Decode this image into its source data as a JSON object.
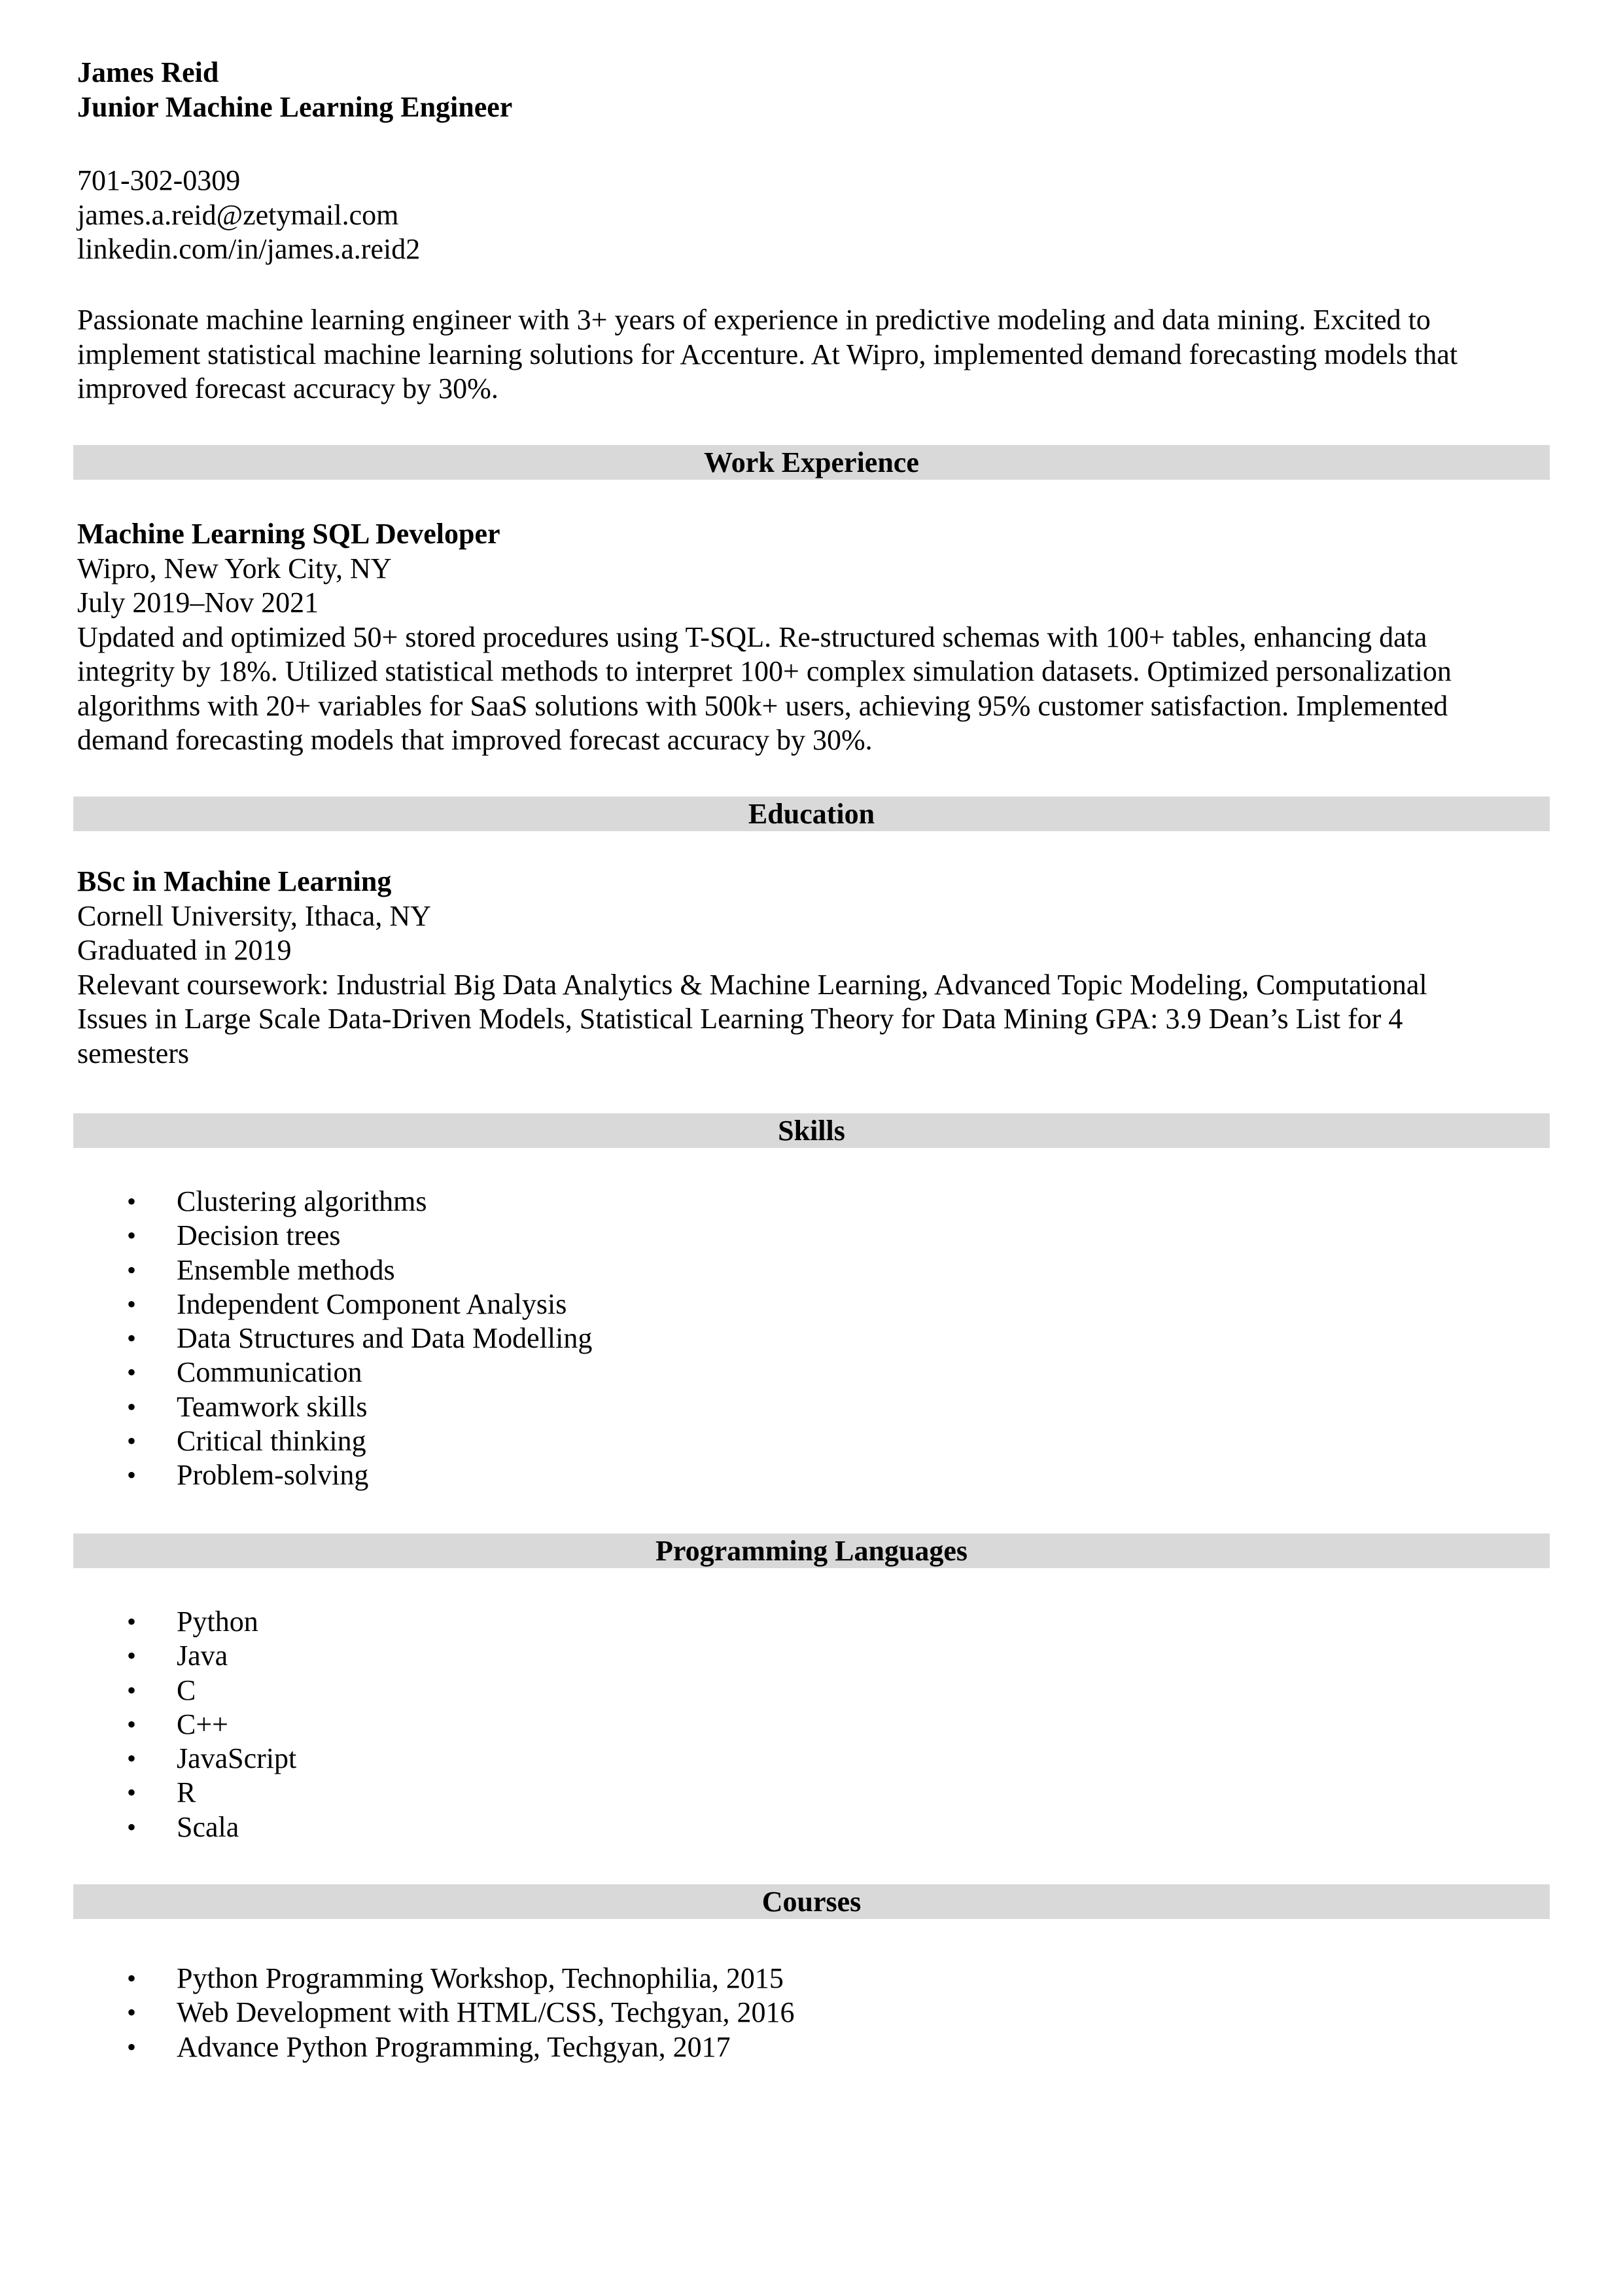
{
  "header": {
    "name": "James Reid",
    "title": "Junior Machine Learning Engineer",
    "phone": "701-302-0309",
    "email": "james.a.reid@zetymail.com",
    "linkedin": "linkedin.com/in/james.a.reid2"
  },
  "summary": {
    "lines": [
      "Passionate machine learning engineer with 3+ years of experience in predictive modeling and data mining. Excited to",
      "implement statistical machine learning solutions for Accenture. At Wipro, implemented demand forecasting models that",
      "improved forecast accuracy by 30%."
    ]
  },
  "sections": {
    "work_experience": "Work Experience",
    "education": "Education",
    "skills": "Skills",
    "programming_languages": "Programming Languages",
    "courses": "Courses"
  },
  "work": {
    "job_title": "Machine Learning SQL Developer",
    "company": "Wipro, New York City, NY",
    "dates": "July 2019–Nov 2021",
    "description_lines": [
      "Updated and optimized 50+ stored procedures using T-SQL. Re-structured schemas with 100+ tables, enhancing data",
      "integrity by 18%.  Utilized statistical methods to interpret 100+ complex simulation datasets.  Optimized personalization",
      "algorithms with 20+ variables for SaaS solutions with 500k+ users, achieving 95% customer satisfaction. Implemented",
      "demand forecasting models that improved forecast accuracy by 30%."
    ]
  },
  "education": {
    "degree": "BSc in Machine Learning",
    "school": "Cornell University, Ithaca, NY",
    "graduated": "Graduated in 2019",
    "coursework_lines": [
      "Relevant coursework: Industrial Big Data Analytics & Machine Learning, Advanced Topic Modeling, Computational",
      "Issues in Large Scale Data-Driven Models, Statistical Learning Theory for Data Mining GPA: 3.9 Dean’s List for 4",
      "semesters"
    ]
  },
  "skills": [
    "Clustering algorithms",
    "Decision trees",
    "Ensemble methods",
    "Independent Component Analysis",
    "Data Structures and Data Modelling",
    "Communication",
    "Teamwork skills",
    "Critical thinking",
    "Problem-solving"
  ],
  "programming_languages": [
    "Python",
    "Java",
    "C",
    "C++",
    "JavaScript",
    "R",
    "Scala"
  ],
  "courses": [
    "Python Programming Workshop, Technophilia, 2015",
    "Web Development with HTML/CSS, Techgyan, 2016",
    "Advance Python Programming, Techgyan, 2017"
  ],
  "bullet_glyph": "•",
  "colors": {
    "band_background": "#d9d9d9",
    "text": "#000000"
  }
}
